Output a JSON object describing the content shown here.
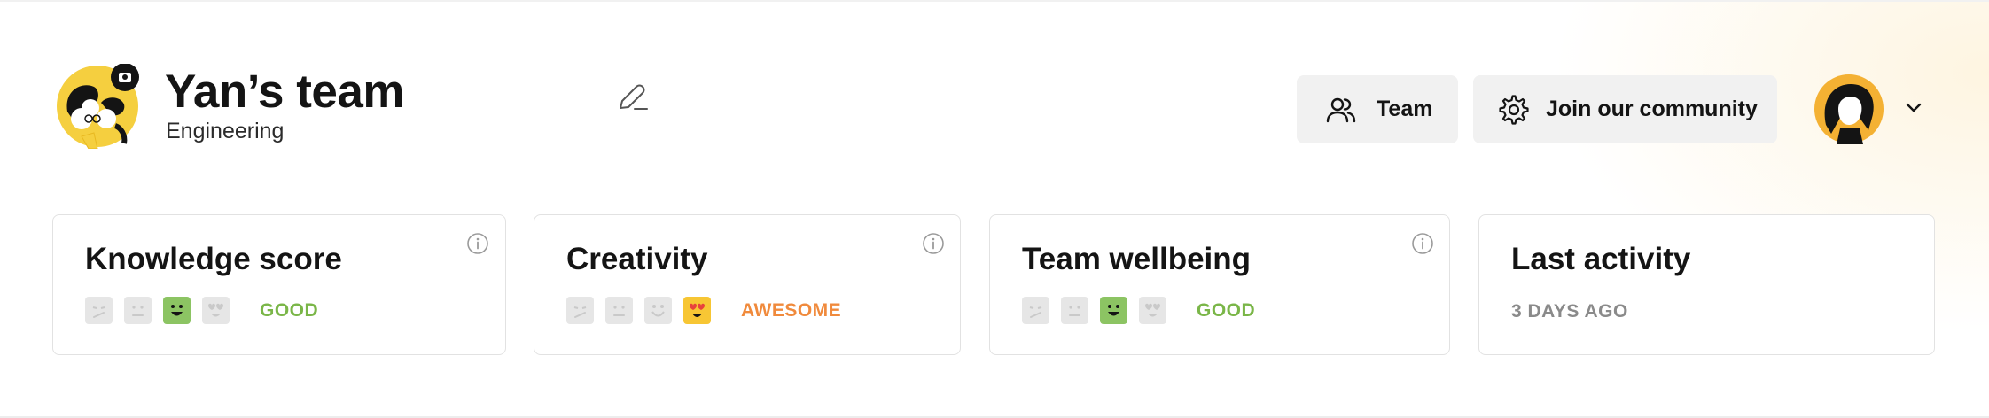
{
  "team": {
    "name": "Yan’s team",
    "department": "Engineering",
    "avatar_icon": "team-illustration-icon",
    "edit_icon": "pencil-icon"
  },
  "header": {
    "team_button": {
      "label": "Team",
      "icon": "users-icon"
    },
    "community_button": {
      "label": "Join our community",
      "icon": "gear-icon"
    },
    "user_menu": {
      "avatar_icon": "user-avatar-icon",
      "toggle_icon": "chevron-down-icon"
    }
  },
  "cards": [
    {
      "title": "Knowledge score",
      "info_icon": "info-icon",
      "faces": [
        "sad",
        "neutral",
        "happy",
        "love"
      ],
      "active_index": 2,
      "rating": "GOOD",
      "rating_color": "#7ab648"
    },
    {
      "title": "Creativity",
      "info_icon": "info-icon",
      "faces": [
        "sad",
        "neutral",
        "happy",
        "love"
      ],
      "active_index": 3,
      "rating": "AWESOME",
      "rating_color": "#f08a3c"
    },
    {
      "title": "Team wellbeing",
      "info_icon": "info-icon",
      "faces": [
        "sad",
        "neutral",
        "happy",
        "love"
      ],
      "active_index": 2,
      "rating": "GOOD",
      "rating_color": "#7ab648"
    },
    {
      "title": "Last activity",
      "value": "3 DAYS AGO"
    }
  ],
  "colors": {
    "brand_yellow": "#f5cf3f",
    "avatar_orange": "#f4b133",
    "good_green": "#8cc463",
    "awesome_yellow": "#f7c634",
    "inactive_face": "#e6e6e6",
    "button_bg": "#f1f1f1"
  }
}
